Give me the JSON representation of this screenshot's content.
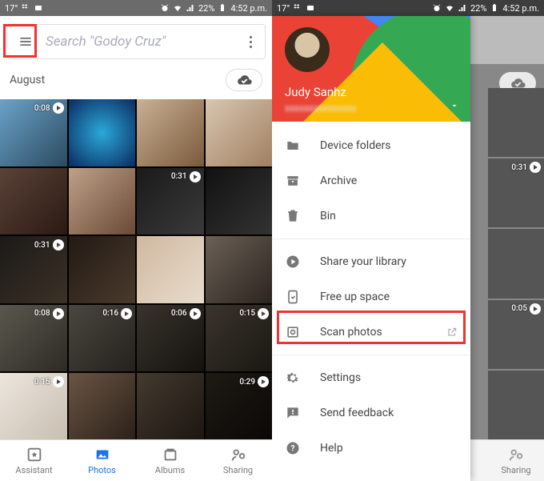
{
  "status": {
    "temp": "17°",
    "battery_pct": "22%",
    "time": "4:52 p.m."
  },
  "search": {
    "placeholder": "Search \"Godoy Cruz\""
  },
  "section": {
    "title": "August"
  },
  "thumbs": [
    {
      "dur": "0:08",
      "video": true
    },
    {
      "dur": "",
      "video": false
    },
    {
      "dur": "",
      "video": false
    },
    {
      "dur": "",
      "video": false
    },
    {
      "dur": "",
      "video": false
    },
    {
      "dur": "",
      "video": false
    },
    {
      "dur": "0:31",
      "video": true
    },
    {
      "dur": "",
      "video": false
    },
    {
      "dur": "0:31",
      "video": true
    },
    {
      "dur": "",
      "video": false
    },
    {
      "dur": "",
      "video": false
    },
    {
      "dur": "",
      "video": false
    },
    {
      "dur": "0:08",
      "video": true
    },
    {
      "dur": "0:16",
      "video": true
    },
    {
      "dur": "0:06",
      "video": true
    },
    {
      "dur": "0:15",
      "video": true
    },
    {
      "dur": "0:15",
      "video": true
    },
    {
      "dur": "",
      "video": false
    },
    {
      "dur": "",
      "video": false
    },
    {
      "dur": "0:29",
      "video": true
    }
  ],
  "nav": {
    "assistant": "Assistant",
    "photos": "Photos",
    "albums": "Albums",
    "sharing": "Sharing"
  },
  "drawer": {
    "user": "Judy Sanhz",
    "items": {
      "device_folders": "Device folders",
      "archive": "Archive",
      "bin": "Bin",
      "share_library": "Share your library",
      "free_up": "Free up space",
      "scan": "Scan photos",
      "settings": "Settings",
      "feedback": "Send feedback",
      "help": "Help"
    }
  },
  "right_thumbs": [
    {
      "dur": "",
      "video": false
    },
    {
      "dur": "0:31",
      "video": true
    },
    {
      "dur": "",
      "video": false
    },
    {
      "dur": "0:05",
      "video": true
    },
    {
      "dur": "",
      "video": false
    }
  ]
}
